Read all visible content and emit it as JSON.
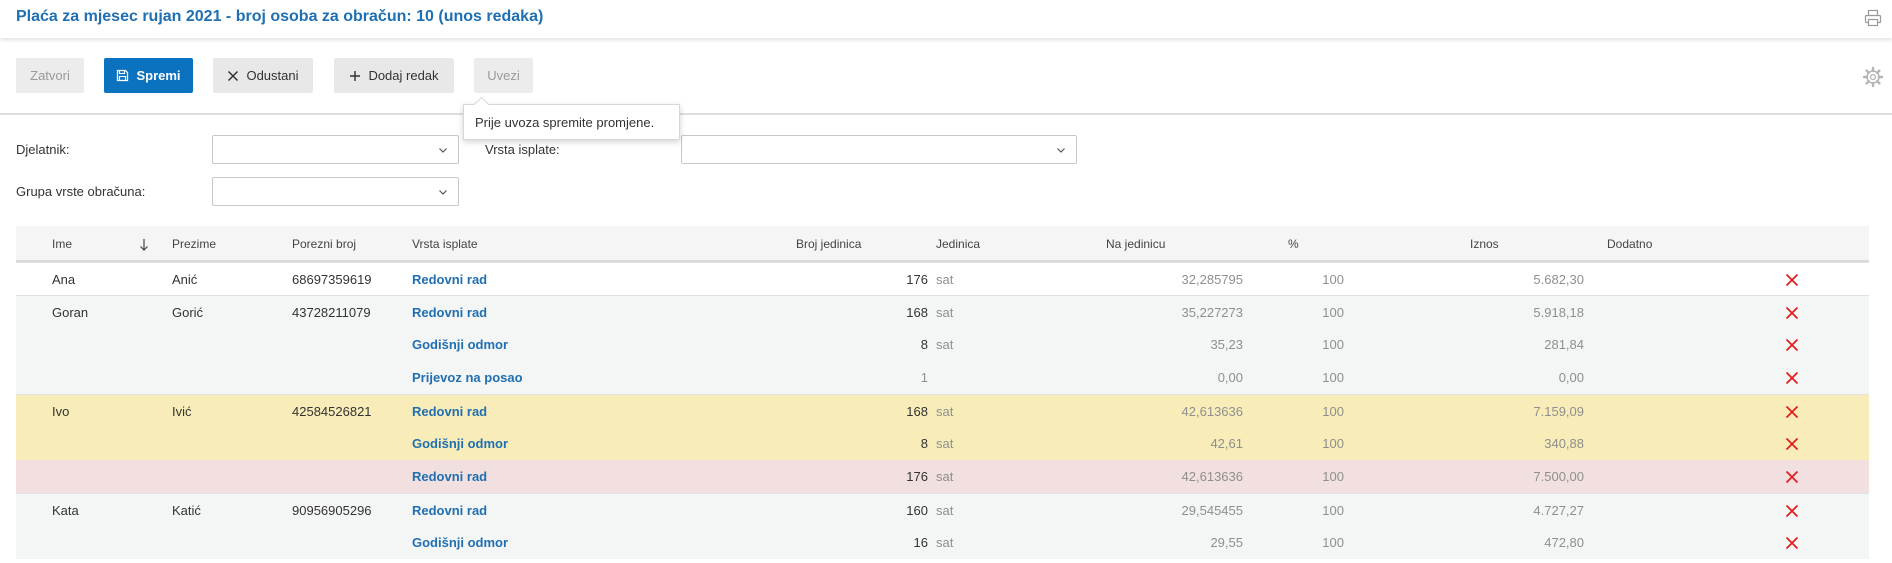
{
  "page": {
    "title": "Plaća za mjesec rujan 2021 - broj osoba za obračun: 10 (unos redaka)",
    "print_icon": "printer-icon"
  },
  "toolbar": {
    "close_label": "Zatvori",
    "save_label": "Spremi",
    "cancel_label": "Odustani",
    "add_row_label": "Dodaj redak",
    "import_label": "Uvezi",
    "settings_icon": "gear-icon",
    "tooltip": "Prije uvoza spremite promjene."
  },
  "filters": {
    "employee_label": "Djelatnik:",
    "employee_value": "",
    "payment_type_label": "Vrsta isplate:",
    "payment_type_value": "",
    "calc_group_label": "Grupa vrste obračuna:",
    "calc_group_value": ""
  },
  "table": {
    "columns": {
      "first_name": "Ime",
      "last_name": "Prezime",
      "tax_number": "Porezni broj",
      "payment_type": "Vrsta isplate",
      "units": "Broj jedinica",
      "unit": "Jedinica",
      "per_unit": "Na jedinicu",
      "percent": "%",
      "amount": "Iznos",
      "extra": "Dodatno"
    },
    "rows": [
      {
        "first_name": "Ana",
        "last_name": "Anić",
        "tax_number": "68697359619",
        "payment_type": "Redovni rad",
        "units": "176",
        "unit": "sat",
        "per_unit": "32,285795",
        "percent": "100",
        "amount": "5.682,30",
        "highlight": "none"
      },
      {
        "first_name": "Goran",
        "last_name": "Gorić",
        "tax_number": "43728211079",
        "payment_type": "Redovni rad",
        "units": "168",
        "unit": "sat",
        "per_unit": "35,227273",
        "percent": "100",
        "amount": "5.918,18",
        "highlight": "none"
      },
      {
        "first_name": "",
        "last_name": "",
        "tax_number": "",
        "payment_type": "Godišnji odmor",
        "units": "8",
        "unit": "sat",
        "per_unit": "35,23",
        "percent": "100",
        "amount": "281,84",
        "highlight": "none"
      },
      {
        "first_name": "",
        "last_name": "",
        "tax_number": "",
        "payment_type": "Prijevoz na posao",
        "units": "1",
        "unit": "",
        "per_unit": "0,00",
        "percent": "100",
        "amount": "0,00",
        "highlight": "none"
      },
      {
        "first_name": "Ivo",
        "last_name": "Ivić",
        "tax_number": "42584526821",
        "payment_type": "Redovni rad",
        "units": "168",
        "unit": "sat",
        "per_unit": "42,613636",
        "percent": "100",
        "amount": "7.159,09",
        "highlight": "yellow"
      },
      {
        "first_name": "",
        "last_name": "",
        "tax_number": "",
        "payment_type": "Godišnji odmor",
        "units": "8",
        "unit": "sat",
        "per_unit": "42,61",
        "percent": "100",
        "amount": "340,88",
        "highlight": "yellow"
      },
      {
        "first_name": "",
        "last_name": "",
        "tax_number": "",
        "payment_type": "Redovni rad",
        "units": "176",
        "unit": "sat",
        "per_unit": "42,613636",
        "percent": "100",
        "amount": "7.500,00",
        "highlight": "red"
      },
      {
        "first_name": "Kata",
        "last_name": "Katić",
        "tax_number": "90956905296",
        "payment_type": "Redovni rad",
        "units": "160",
        "unit": "sat",
        "per_unit": "29,545455",
        "percent": "100",
        "amount": "4.727,27",
        "highlight": "none"
      },
      {
        "first_name": "",
        "last_name": "",
        "tax_number": "",
        "payment_type": "Godišnji odmor",
        "units": "16",
        "unit": "sat",
        "per_unit": "29,55",
        "percent": "100",
        "amount": "472,80",
        "highlight": "none"
      }
    ]
  },
  "colors": {
    "accent": "#1f6fb2",
    "primary_button": "#0b72c0",
    "row_yellow": "#f8edb8",
    "row_red": "#f2dfdf",
    "delete_red": "#e02020"
  }
}
